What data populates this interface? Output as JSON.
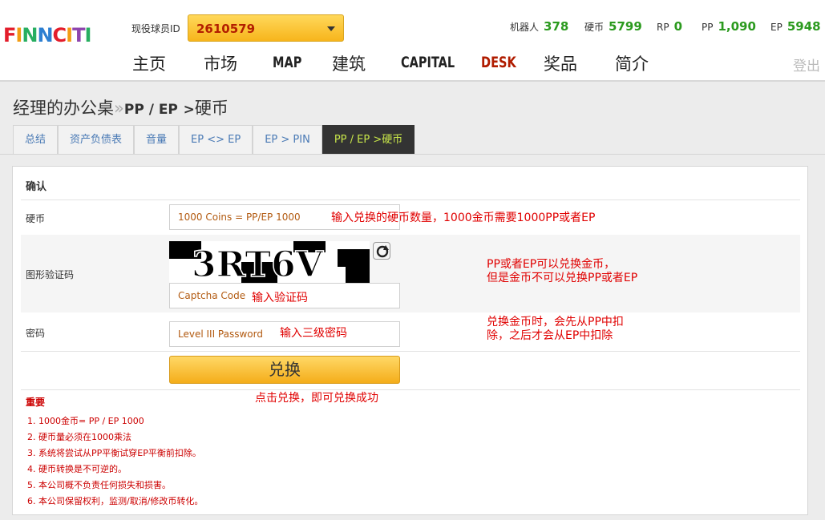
{
  "header": {
    "logo_text": "FINNCITI",
    "player_id_label": "现役球员ID",
    "player_id_value": "2610579",
    "stats": [
      {
        "label": "机器人",
        "value": "378"
      },
      {
        "label": "硬币",
        "value": "5799"
      },
      {
        "label": "RP",
        "value": "0"
      },
      {
        "label": "PP",
        "value": "1,090"
      },
      {
        "label": "EP",
        "value": "5948"
      }
    ],
    "nav": [
      "主页",
      "市场",
      "MAP",
      "建筑",
      "CAPITAL",
      "DESK",
      "奖品",
      "简介"
    ],
    "logout": "登出"
  },
  "breadcrumb": {
    "root": "经理的办公桌",
    "sep": "»",
    "current_pp": "PP / EP",
    "gt": ">",
    "current": "硬币"
  },
  "tabs": [
    "总结",
    "资产负债表",
    "音量",
    "EP <> EP",
    "EP > PIN",
    "PP / EP >硬币"
  ],
  "form": {
    "heading": "确认",
    "coins_label": "硬币",
    "coins_placeholder": "1000 Coins = PP/EP 1000",
    "captcha_label": "图形验证码",
    "captcha_text": "3RT6V",
    "captcha_placeholder": "Captcha Code",
    "password_label": "密码",
    "password_placeholder": "Level III Password",
    "submit": "兑换"
  },
  "annotations": {
    "coins": "输入兑换的硬币数量，1000金币需要1000PP或者EP",
    "captcha": "输入验证码",
    "ppep_1": "PP或者EP可以兑换金币，",
    "ppep_2": "但是金币不可以兑换PP或者EP",
    "password": "输入三级密码",
    "deduct_1": "兑换金币时，会先从PP中扣",
    "deduct_2": "除，之后才会从EP中扣除",
    "click": "点击兑换，即可兑换成功"
  },
  "notes": {
    "title": "重要",
    "items": [
      "1.  1000金币= PP / EP 1000",
      "2.  硬币量必须在1000乘法",
      "3.  系统将尝试从PP平衡试穿EP平衡前扣除。",
      "4.  硬币转换是不可逆的。",
      "5.  本公司概不负责任何损失和损害。",
      "6.  本公司保留权利，监测/取消/修改币转化。"
    ]
  }
}
